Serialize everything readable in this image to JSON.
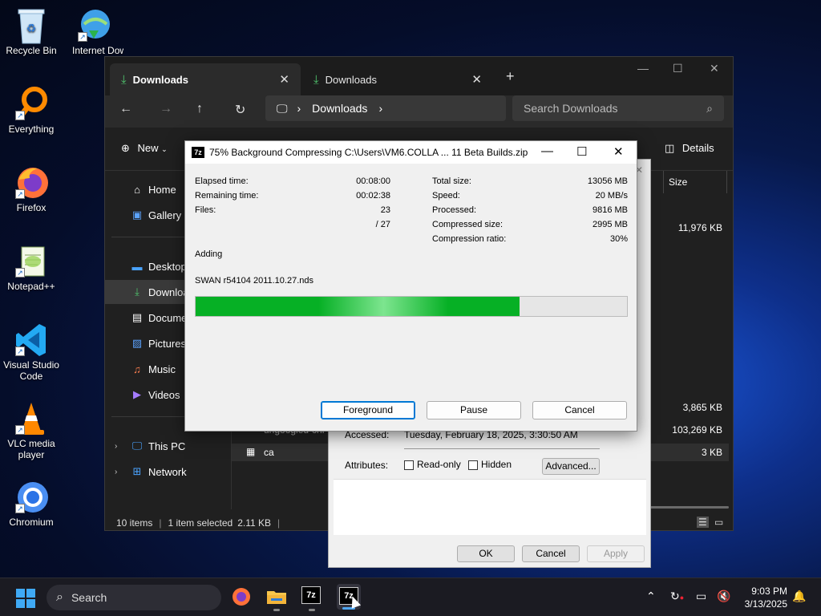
{
  "desktop": {
    "icons": [
      {
        "label": "Recycle Bin"
      },
      {
        "label": "Internet Downlo"
      },
      {
        "label": "Everything"
      },
      {
        "label": "Firefox"
      },
      {
        "label": "Notepad++"
      },
      {
        "label": "Visual Studio Code"
      },
      {
        "label": "VLC media player"
      },
      {
        "label": "Chromium"
      }
    ]
  },
  "explorer": {
    "tabs": [
      {
        "label": "Downloads"
      },
      {
        "label": "Downloads"
      }
    ],
    "breadcrumb": "Downloads",
    "search_placeholder": "Search Downloads",
    "new_label": "New",
    "details_label": "Details",
    "column_size": "Size",
    "sidebar": [
      {
        "label": "Home"
      },
      {
        "label": "Gallery"
      },
      {
        "label": "Desktop"
      },
      {
        "label": "Downloads"
      },
      {
        "label": "Documents"
      },
      {
        "label": "Pictures"
      },
      {
        "label": "Music"
      },
      {
        "label": "Videos"
      },
      {
        "label": "This PC"
      },
      {
        "label": "Network"
      }
    ],
    "rows": [
      {
        "name": "",
        "size": "11,976 KB"
      },
      {
        "name": "",
        "size": "3,865 KB"
      },
      {
        "name": "ungoogled-chr",
        "size": "103,269 KB"
      },
      {
        "name": "ca",
        "size": "3 KB"
      }
    ],
    "status": {
      "items": "10 items",
      "selected": "1 item selected",
      "size": "2.11 KB"
    }
  },
  "properties": {
    "accessed_label": "Accessed:",
    "accessed_value": "Tuesday, February 18, 2025, 3:30:50 AM",
    "attributes_label": "Attributes:",
    "readonly_label": "Read-only",
    "hidden_label": "Hidden",
    "advanced_label": "Advanced...",
    "ok_label": "OK",
    "cancel_label": "Cancel",
    "apply_label": "Apply"
  },
  "zip": {
    "title": "75% Background Compressing C:\\Users\\VM6.COLLA ... 11 Beta Builds.zip",
    "elapsed_label": "Elapsed time:",
    "elapsed": "00:08:00",
    "remaining_label": "Remaining time:",
    "remaining": "00:02:38",
    "files_label": "Files:",
    "files": "23",
    "files_total": "/ 27",
    "total_size_label": "Total size:",
    "total_size": "13056 MB",
    "speed_label": "Speed:",
    "speed": "20 MB/s",
    "processed_label": "Processed:",
    "processed": "9816 MB",
    "compressed_label": "Compressed size:",
    "compressed": "2995 MB",
    "ratio_label": "Compression ratio:",
    "ratio": "30%",
    "action": "Adding",
    "current_file": "SWAN r54104 2011.10.27.nds",
    "progress": 0.75,
    "foreground_label": "Foreground",
    "pause_label": "Pause",
    "cancel_label": "Cancel"
  },
  "taskbar": {
    "search_label": "Search",
    "time": "9:03 PM",
    "date": "3/13/2025"
  },
  "colors": {
    "progress": "#06b025",
    "accent": "#0078d4"
  }
}
